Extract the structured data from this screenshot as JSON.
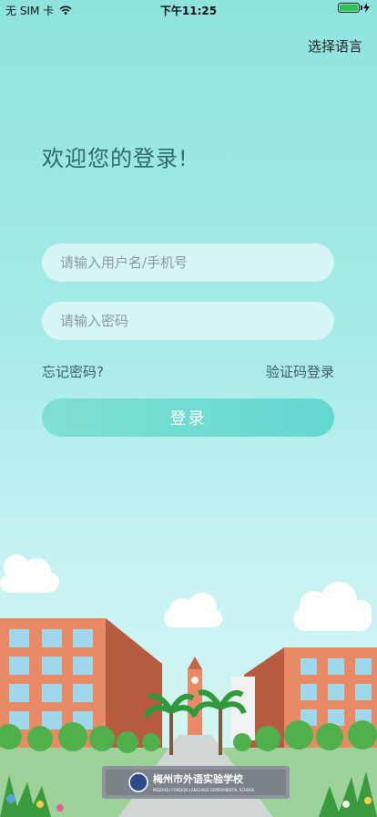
{
  "status_bar": {
    "carrier": "无 SIM 卡",
    "time": "下午11:25",
    "battery_level": 1.0
  },
  "header": {
    "select_language": "选择语言"
  },
  "welcome_text": "欢迎您的登录!",
  "form": {
    "username_placeholder": "请输入用户名/手机号",
    "password_placeholder": "请输入密码",
    "forgot_password": "忘记密码?",
    "sms_login": "验证码登录",
    "login_button": "登录"
  },
  "illustration": {
    "sign_title": "梅州市外语实验学校",
    "sign_subtitle": "MEIZHOU FOREIGN LANGUAGE EXPERIMENTAL SCHOOL"
  },
  "colors": {
    "background_top": "#8ee3df",
    "accent": "#63d8d1",
    "title": "#2f6a66"
  }
}
